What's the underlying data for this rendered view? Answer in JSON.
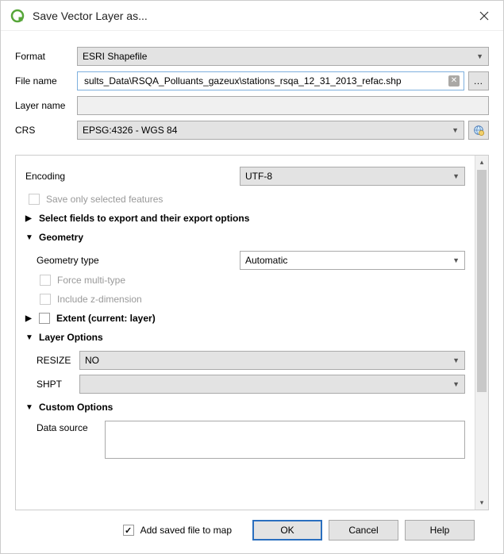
{
  "window": {
    "title": "Save Vector Layer as..."
  },
  "form": {
    "format_label": "Format",
    "format_value": "ESRI Shapefile",
    "filename_label": "File name",
    "filename_value": "sults_Data\\RSQA_Polluants_gazeux\\stations_rsqa_12_31_2013_refac.shp",
    "browse_label": "…",
    "layername_label": "Layer name",
    "layername_value": "",
    "crs_label": "CRS",
    "crs_value": "EPSG:4326 - WGS 84"
  },
  "panel": {
    "encoding_label": "Encoding",
    "encoding_value": "UTF-8",
    "save_selected_label": "Save only selected features",
    "select_fields_header": "Select fields to export and their export options",
    "geometry_header": "Geometry",
    "geometry_type_label": "Geometry type",
    "geometry_type_value": "Automatic",
    "force_multitype_label": "Force multi-type",
    "include_z_label": "Include z-dimension",
    "extent_header": "Extent (current: layer)",
    "layer_options_header": "Layer Options",
    "resize_label": "RESIZE",
    "resize_value": "NO",
    "shpt_label": "SHPT",
    "shpt_value": "",
    "custom_options_header": "Custom Options",
    "data_source_label": "Data source"
  },
  "footer": {
    "add_to_map_label": "Add saved file to map",
    "ok": "OK",
    "cancel": "Cancel",
    "help": "Help"
  }
}
